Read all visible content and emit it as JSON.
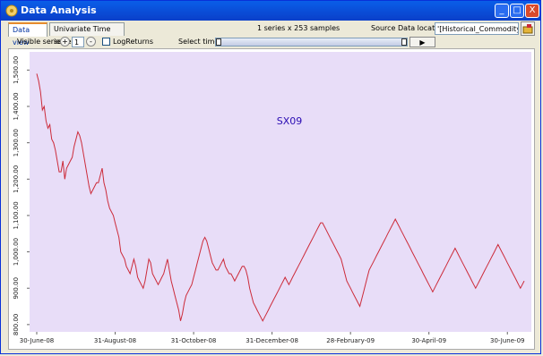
{
  "window": {
    "title": "Data Analysis",
    "minimize": "_",
    "maximize": "□",
    "close": "X"
  },
  "tabs": [
    {
      "label": "Data view",
      "active": true
    },
    {
      "label": "Univariate Time series",
      "active": false
    }
  ],
  "info": {
    "samples_text": "1 series  x  253 samples"
  },
  "source": {
    "label": "Source Data location :",
    "value": "'[Historical_Commodity_Prices"
  },
  "controls": {
    "visible_series_label": "Visible series :",
    "plus": "+",
    "visible_series_value": "1",
    "minus": "-",
    "logreturns_label": "LogReturns",
    "select_times_label": "Select times:",
    "play_label": "play",
    "play_icon": "▶"
  },
  "colors": {
    "plot_bg": "#e8ddf8",
    "line": "#cc2b3a",
    "series_label": "#2a0cb3"
  },
  "chart_data": {
    "type": "line",
    "title": "",
    "series": [
      {
        "name": "SX09",
        "values": [
          1490,
          1470,
          1440,
          1390,
          1400,
          1360,
          1340,
          1350,
          1310,
          1300,
          1280,
          1250,
          1220,
          1220,
          1250,
          1200,
          1230,
          1240,
          1250,
          1260,
          1290,
          1310,
          1330,
          1320,
          1300,
          1270,
          1240,
          1210,
          1180,
          1160,
          1170,
          1180,
          1190,
          1190,
          1210,
          1230,
          1190,
          1170,
          1140,
          1120,
          1110,
          1100,
          1080,
          1060,
          1040,
          1000,
          990,
          980,
          960,
          950,
          940,
          960,
          980,
          960,
          930,
          920,
          910,
          900,
          920,
          950,
          980,
          970,
          940,
          930,
          920,
          910,
          920,
          930,
          940,
          960,
          980,
          950,
          920,
          900,
          880,
          860,
          840,
          810,
          830,
          860,
          880,
          890,
          900,
          910,
          930,
          950,
          970,
          990,
          1010,
          1030,
          1040,
          1030,
          1010,
          990,
          970,
          960,
          950,
          950,
          960,
          970,
          980,
          960,
          950,
          940,
          940,
          930,
          920,
          930,
          940,
          950,
          960,
          960,
          950,
          930,
          900,
          880,
          860,
          850,
          840,
          830,
          820,
          810,
          820,
          830,
          840,
          850,
          860,
          870,
          880,
          890,
          900,
          910,
          920,
          930,
          920,
          910,
          920,
          930,
          940,
          950,
          960,
          970,
          980,
          990,
          1000,
          1010,
          1020,
          1030,
          1040,
          1050,
          1060,
          1070,
          1080,
          1080,
          1070,
          1060,
          1050,
          1040,
          1030,
          1020,
          1010,
          1000,
          990,
          980,
          960,
          940,
          920,
          910,
          900,
          890,
          880,
          870,
          860,
          850,
          870,
          890,
          910,
          930,
          950,
          960,
          970,
          980,
          990,
          1000,
          1010,
          1020,
          1030,
          1040,
          1050,
          1060,
          1070,
          1080,
          1090,
          1080,
          1070,
          1060,
          1050,
          1040,
          1030,
          1020,
          1010,
          1000,
          990,
          980,
          970,
          960,
          950,
          940,
          930,
          920,
          910,
          900,
          890,
          900,
          910,
          920,
          930,
          940,
          950,
          960,
          970,
          980,
          990,
          1000,
          1010,
          1000,
          990,
          980,
          970,
          960,
          950,
          940,
          930,
          920,
          910,
          900,
          910,
          920,
          930,
          940,
          950,
          960,
          970,
          980,
          990,
          1000,
          1010,
          1020,
          1010,
          1000,
          990,
          980,
          970,
          960,
          950,
          940,
          930,
          920,
          910,
          900,
          910,
          920
        ]
      }
    ],
    "x_ticks": [
      "30-June-08",
      "31-August-08",
      "31-October-08",
      "31-December-08",
      "28-February-09",
      "30-April-09",
      "30-June-09"
    ],
    "y_ticks": [
      "800.00",
      "900.00",
      "1,000.00",
      "1,100.00",
      "1,200.00",
      "1,300.00",
      "1,400.00",
      "1,500.00"
    ],
    "ylim": [
      780,
      1550
    ],
    "grid": false
  }
}
